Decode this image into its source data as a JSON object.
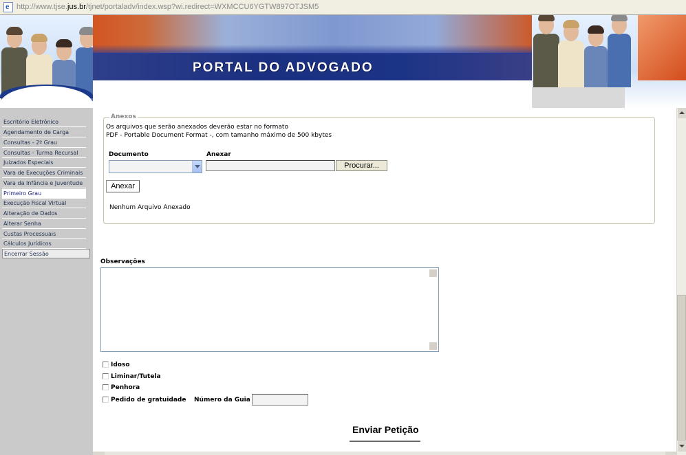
{
  "address_bar": {
    "url_prefix": "http://www.tjse.",
    "url_domain": "jus.br",
    "url_suffix": "/tjnet/portaladv/index.wsp?wi.redirect=WXMCCU6YGTW897OTJSM5"
  },
  "banner": {
    "title": "PORTAL DO ADVOGADO"
  },
  "sidebar": {
    "items": [
      {
        "label": "Escritório Eletrônico",
        "active": false
      },
      {
        "label": "Agendamento de Carga",
        "active": false
      },
      {
        "label": "Consultas - 2º Grau",
        "active": false
      },
      {
        "label": "Consultas - Turma Recursal",
        "active": false
      },
      {
        "label": "Juizados Especiais",
        "active": false
      },
      {
        "label": "Vara de Execuções Criminais",
        "active": false
      },
      {
        "label": "Vara da Infância e Juventude",
        "active": false
      },
      {
        "label": "Primeiro Grau",
        "active": true
      },
      {
        "label": "Execução Fiscal Virtual",
        "active": false
      },
      {
        "label": "Alteração de Dados",
        "active": false
      },
      {
        "label": "Alterar Senha",
        "active": false
      },
      {
        "label": "Custas Processuais",
        "active": false
      },
      {
        "label": "Cálculos Jurídicos",
        "active": false
      },
      {
        "label": "Encerrar Sessão",
        "active": false
      }
    ]
  },
  "anexos": {
    "legend": "Anexos",
    "info_line1": "Os arquivos que serão anexados deverão estar no formato",
    "info_line2": "PDF - Portable Document Format -, com tamanho máximo de 500 kbytes",
    "documento_label": "Documento",
    "documento_value": "",
    "anexar_label": "Anexar",
    "anexar_value": "",
    "browse_button": "Procurar...",
    "anexar_button": "Anexar",
    "status": "Nenhum Arquivo Anexado"
  },
  "observacoes": {
    "label": "Observações",
    "value": ""
  },
  "flags": [
    {
      "label": "Idoso",
      "checked": false
    },
    {
      "label": "Liminar/Tutela",
      "checked": false
    },
    {
      "label": "Penhora",
      "checked": false
    },
    {
      "label": "Pedido de gratuidade",
      "checked": false
    }
  ],
  "guia": {
    "label": "Número da Guia",
    "value": ""
  },
  "submit": {
    "label": "Enviar Petição"
  },
  "colors": {
    "nav_background": "#cacaca",
    "banner_blue": "#1c3a8c",
    "banner_orange": "#d45522"
  }
}
